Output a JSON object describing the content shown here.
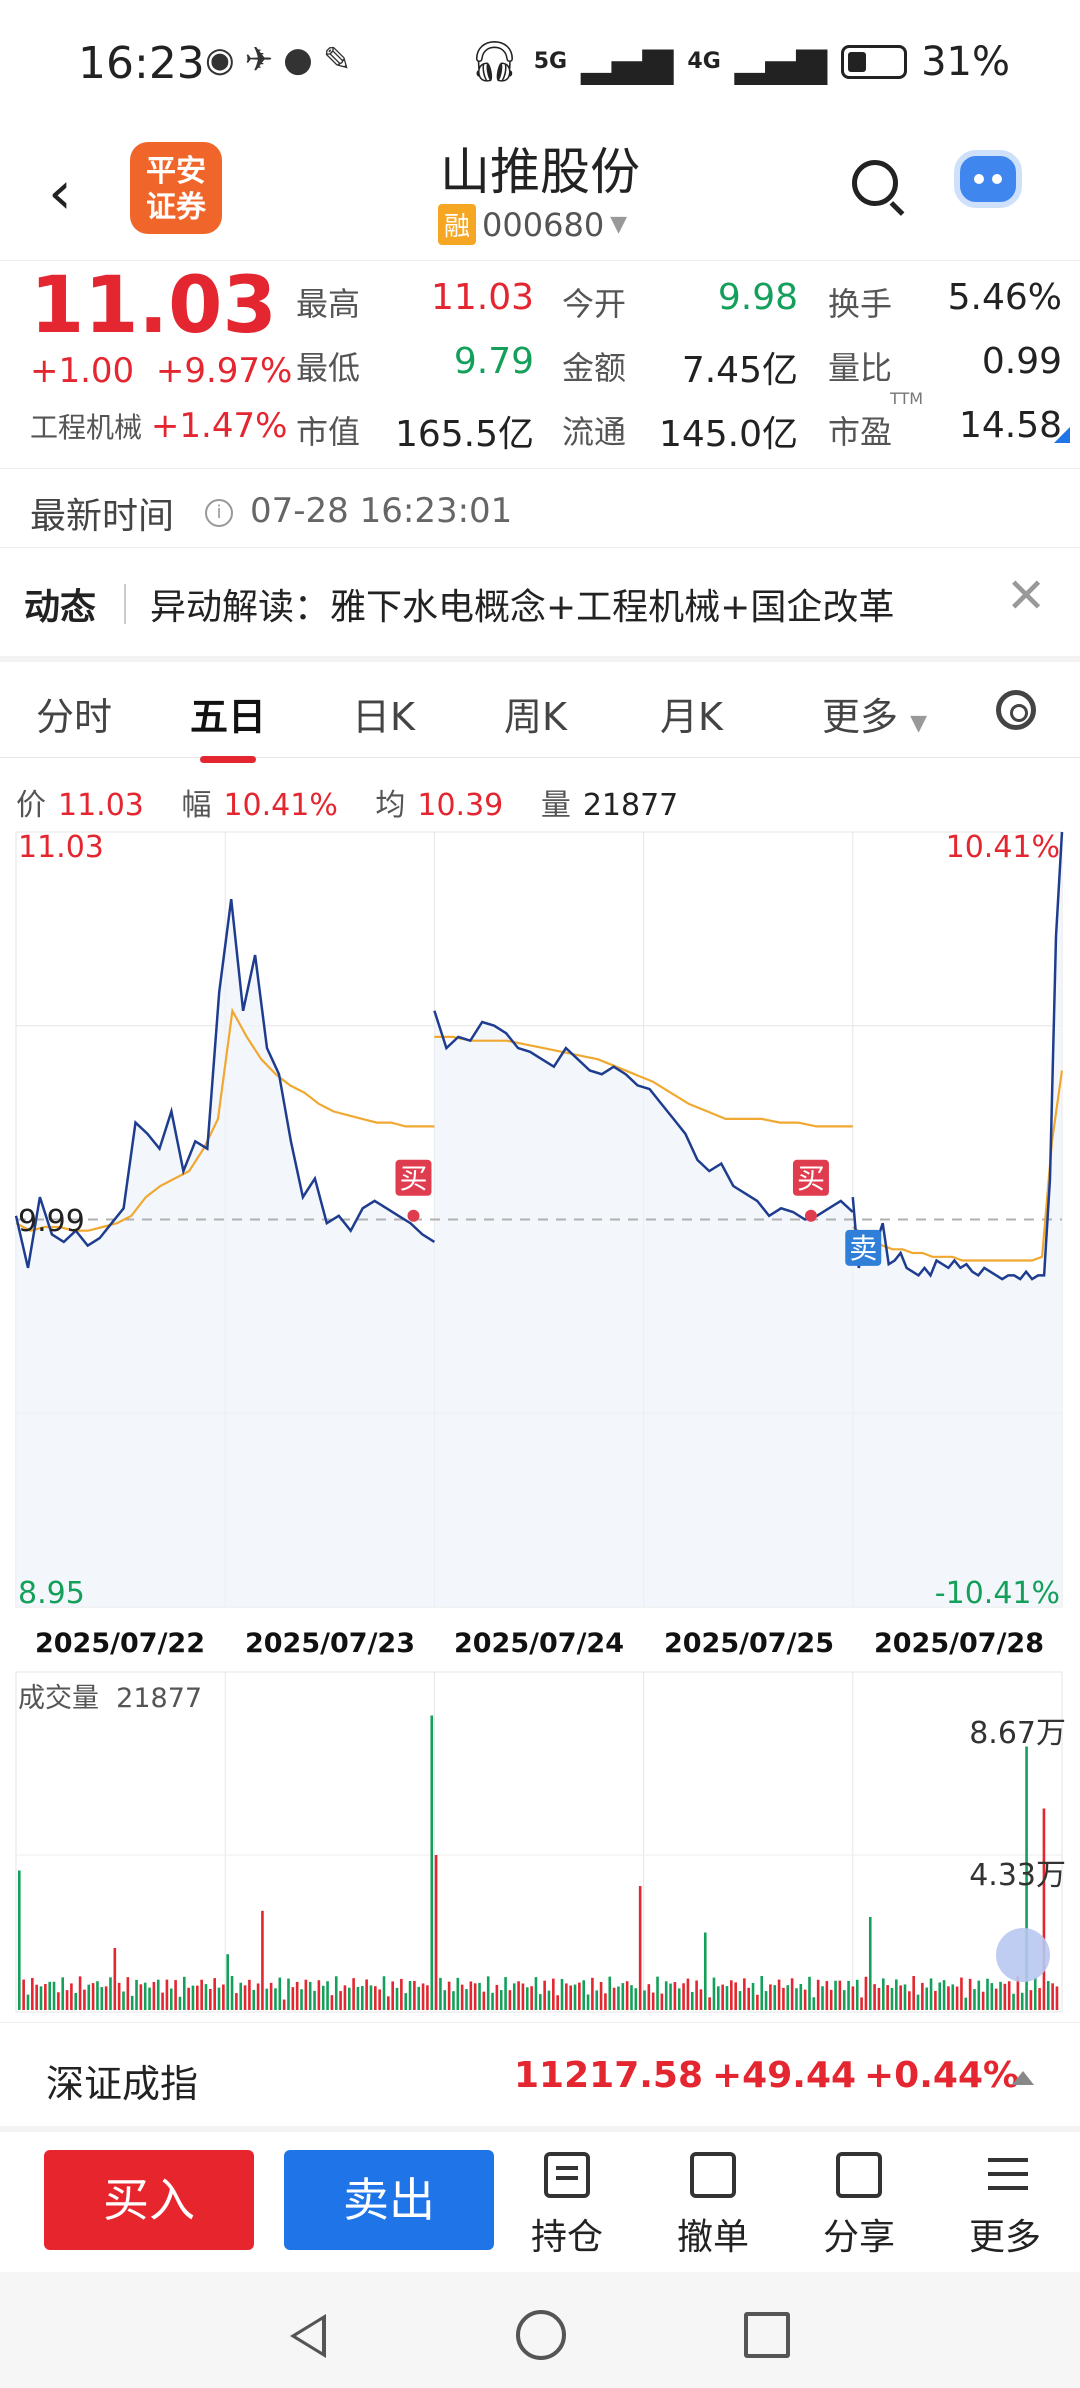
{
  "status_bar": {
    "time": "16:23",
    "battery": "31%",
    "signal1": "5G",
    "signal2": "4G"
  },
  "header": {
    "back_icon": "chevron-left-icon",
    "broker_logo_text": "平安证券",
    "stock_name": "山推股份",
    "badge": "融",
    "code": "000680"
  },
  "quote": {
    "price": "11.03",
    "change": "+1.00",
    "change_pct": "+9.97%",
    "industry_label": "工程机械",
    "industry_pct": "+1.47%",
    "stats": [
      {
        "label": "最高",
        "value": "11.03",
        "color": "red"
      },
      {
        "label": "今开",
        "value": "9.98",
        "color": "green"
      },
      {
        "label": "换手",
        "value": "5.46%",
        "color": "dark"
      },
      {
        "label": "最低",
        "value": "9.79",
        "color": "green"
      },
      {
        "label": "金额",
        "value": "7.45亿",
        "color": "dark"
      },
      {
        "label": "量比",
        "value": "0.99",
        "color": "dark"
      },
      {
        "label": "市值",
        "value": "165.5亿",
        "color": "dark"
      },
      {
        "label": "流通",
        "value": "145.0亿",
        "color": "dark"
      },
      {
        "label": "市盈",
        "value": "14.58",
        "color": "dark",
        "sup": "TTM"
      }
    ]
  },
  "update_time": {
    "label": "最新时间",
    "value": "07-28 16:23:01"
  },
  "news": {
    "tag": "动态",
    "text": "异动解读：雅下水电概念+工程机械+国企改革"
  },
  "tabs": [
    "分时",
    "五日",
    "日K",
    "周K",
    "月K",
    "更多"
  ],
  "active_tab": "五日",
  "legend": {
    "price_label": "价",
    "price_value": "11.03",
    "range_label": "幅",
    "range_value": "10.41%",
    "avg_label": "均",
    "avg_value": "10.39",
    "vol_label": "量",
    "vol_value": "21877"
  },
  "chart_data": {
    "type": "line",
    "dates": [
      "2025/07/22",
      "2025/07/23",
      "2025/07/24",
      "2025/07/25",
      "2025/07/28"
    ],
    "y_top_label": "11.03",
    "y_mid_label": "9.99",
    "y_bottom_label": "8.95",
    "pct_top_label": "10.41%",
    "pct_bottom_label": "-10.41%",
    "ylim": [
      8.95,
      11.03
    ],
    "prev_close": 9.99,
    "price_series": [
      [
        10.0,
        9.86,
        10.05,
        9.95,
        9.93,
        9.96,
        9.92,
        9.94,
        9.98,
        10.02,
        10.25,
        10.22,
        10.18,
        10.28,
        10.12,
        10.2,
        10.18,
        10.6,
        10.85,
        10.55,
        10.7,
        10.45,
        10.38,
        10.2,
        10.05,
        10.1,
        9.98,
        10.0,
        9.96,
        10.02,
        10.04,
        10.02,
        10.0,
        9.98,
        9.95,
        9.93
      ],
      [
        10.55,
        10.45,
        10.48,
        10.47,
        10.52,
        10.51,
        10.49,
        10.45,
        10.44,
        10.42,
        10.4,
        10.45,
        10.42,
        10.39,
        10.38,
        10.4,
        10.38,
        10.35,
        10.34,
        10.3,
        10.26,
        10.22,
        10.15,
        10.12,
        10.14,
        10.08,
        10.06,
        10.04,
        10.0,
        10.02,
        10.01,
        9.99,
        10.0,
        10.02,
        10.04,
        10.01
      ],
      [
        10.05,
        9.86,
        9.95,
        9.92,
        9.93,
        9.98,
        9.87,
        9.88,
        9.9,
        9.86,
        9.85,
        9.84,
        9.86,
        9.84,
        9.88,
        9.87,
        9.86,
        9.88,
        9.86,
        9.87,
        9.85,
        9.84,
        9.86,
        9.85,
        9.84,
        9.83,
        9.84,
        9.84,
        9.83,
        9.85,
        9.83,
        9.84,
        9.84,
        10.1,
        10.75,
        11.03
      ]
    ],
    "avg_series": [
      [
        9.98,
        9.96,
        9.97,
        9.97,
        9.96,
        9.96,
        9.97,
        9.98,
        10.0,
        10.05,
        10.08,
        10.1,
        10.12,
        10.18,
        10.26,
        10.55,
        10.48,
        10.42,
        10.38,
        10.35,
        10.33,
        10.3,
        10.28,
        10.27,
        10.26,
        10.25,
        10.25,
        10.24,
        10.24,
        10.24
      ],
      [
        10.48,
        10.48,
        10.47,
        10.47,
        10.47,
        10.46,
        10.45,
        10.44,
        10.43,
        10.42,
        10.4,
        10.38,
        10.36,
        10.33,
        10.3,
        10.28,
        10.26,
        10.26,
        10.26,
        10.25,
        10.25,
        10.24,
        10.24,
        10.24
      ],
      [
        9.97,
        9.95,
        9.93,
        9.92,
        9.91,
        9.91,
        9.9,
        9.9,
        9.89,
        9.89,
        9.89,
        9.88,
        9.88,
        9.88,
        9.88,
        9.88,
        9.88,
        9.88,
        9.88,
        9.89,
        10.2,
        10.39
      ]
    ],
    "markers": [
      {
        "label": "买",
        "kind": "buy"
      },
      {
        "label": "买",
        "kind": "buy"
      },
      {
        "label": "卖",
        "kind": "sell"
      }
    ],
    "volume_label": "成交量",
    "volume_value": "21877",
    "volume_axis": [
      "8.67万",
      "4.33万"
    ],
    "volume_max": 86700
  },
  "index_bar": {
    "name": "深证成指",
    "value": "11217.58",
    "change": "+49.44",
    "pct": "+0.44%"
  },
  "actions": {
    "buy": "买入",
    "sell": "卖出",
    "items": [
      "持仓",
      "撤单",
      "分享",
      "更多"
    ]
  },
  "colors": {
    "up": "#e3262f",
    "down": "#14a05a",
    "price_line": "#1e3d8f",
    "avg_line": "#f0a830",
    "buy_marker": "#e03c4f",
    "sell_marker": "#2f7fd8"
  }
}
